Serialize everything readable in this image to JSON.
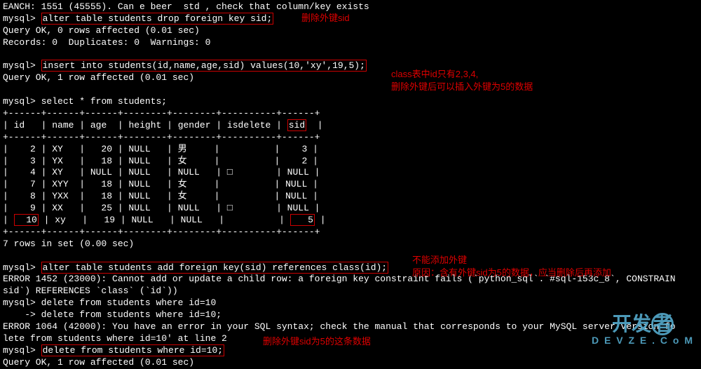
{
  "line0": "EANCH: 1551 (45555). Can e beer  std , check that column/key exists",
  "prompt": "mysql>",
  "cmd1": "alter table students drop foreign key sid;",
  "ann1": "删除外键sid",
  "res1a": "Query OK, 0 rows affected (0.01 sec)",
  "res1b": "Records: 0  Duplicates: 0  Warnings: 0",
  "cmd2": "insert into students(id,name,age,sid) values(10,'xy',19,5);",
  "ann2a": "class表中id只有2,3,4,",
  "ann2b": "删除外键后可以插入外键为5的数据",
  "res2": "Query OK, 1 row affected (0.01 sec)",
  "cmd3": "select * from students;",
  "tableBorder": "+------+------+------+--------+--------+----------+------+",
  "tableHeader": {
    "id": "id",
    "name": "name",
    "age": "age",
    "height": "height",
    "gender": "gender",
    "isdelete": "isdelete",
    "sid": "sid"
  },
  "chart_data": {
    "type": "table",
    "columns": [
      "id",
      "name",
      "age",
      "height",
      "gender",
      "isdelete",
      "sid"
    ],
    "rows": [
      {
        "id": 2,
        "name": "XY",
        "age": 20,
        "height": "NULL",
        "gender": "男",
        "isdelete": "",
        "sid": 3
      },
      {
        "id": 3,
        "name": "YX",
        "age": 18,
        "height": "NULL",
        "gender": "女",
        "isdelete": "",
        "sid": 2
      },
      {
        "id": 4,
        "name": "XY",
        "age": "NULL",
        "height": "NULL",
        "gender": "NULL",
        "isdelete": "□",
        "sid": "NULL"
      },
      {
        "id": 7,
        "name": "XYY",
        "age": 18,
        "height": "NULL",
        "gender": "女",
        "isdelete": "",
        "sid": "NULL"
      },
      {
        "id": 8,
        "name": "YXX",
        "age": 18,
        "height": "NULL",
        "gender": "女",
        "isdelete": "",
        "sid": "NULL"
      },
      {
        "id": 9,
        "name": "XX",
        "age": 25,
        "height": "NULL",
        "gender": "NULL",
        "isdelete": "□",
        "sid": "NULL"
      },
      {
        "id": 10,
        "name": "xy",
        "age": 19,
        "height": "NULL",
        "gender": "NULL",
        "isdelete": "",
        "sid": 5
      }
    ]
  },
  "row1": "|    2 | XY   |   20 | NULL   | 男     |          |    3 |",
  "row2": "|    3 | YX   |   18 | NULL   | 女     |          |    2 |",
  "row3": "|    4 | XY   | NULL | NULL   | NULL   | □        | NULL |",
  "row4": "|    7 | XYY  |   18 | NULL   | 女     |          | NULL |",
  "row5": "|    8 | YXX  |   18 | NULL   | 女     |          | NULL |",
  "row6": "|    9 | XX   |   25 | NULL   | NULL   | □        | NULL |",
  "row7a": "| ",
  "row7id": "  10",
  "row7b": " | xy   |   19 | NULL   | NULL   |          | ",
  "row7sid": "   5",
  "row7c": " |",
  "res3": "7 rows in set (0.00 sec)",
  "cmd4": "alter table students add foreign key(sid) references class(id);",
  "ann4a": "不能添加外键",
  "ann4b": "原因：含有外键sid为5的数据，应当删除后再添加",
  "err1": "ERROR 1452 (23000): Cannot add or update a child row: a foreign key constraint fails (`python_sql`.`#sql-153c_8`, CONSTRAIN",
  "err1b": "sid`) REFERENCES `class` (`id`))",
  "cmd5": "delete from students where id=10",
  "cmd5cont": "    -> delete from students where id=10;",
  "err2": "ERROR 1064 (42000): You have an error in your SQL syntax; check the manual that corresponds to your MySQL server version fo",
  "err2b": "lete from students where id=10' at line 2",
  "cmd6": "delete from students where id=10;",
  "ann6": "删除外键sid为5的这条数据",
  "res6": "Query OK, 1 row affected (0.01 sec)",
  "watermark_main": "开发",
  "watermark_char": "者",
  "watermark_url": "D  E  V  Z  E  .  C  o  M"
}
